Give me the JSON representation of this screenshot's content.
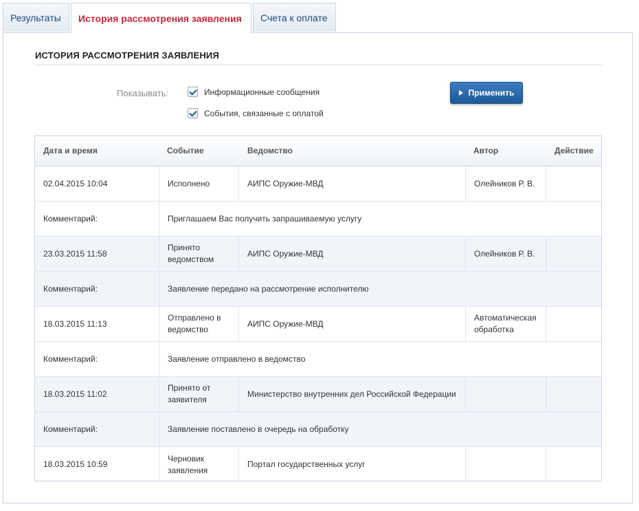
{
  "tabs": [
    {
      "label": "Результаты"
    },
    {
      "label": "История рассмотрения заявления"
    },
    {
      "label": "Счета к оплате"
    }
  ],
  "section_title": "ИСТОРИЯ РАССМОТРЕНИЯ ЗАЯВЛЕНИЯ",
  "filter": {
    "label": "Показывать:",
    "options": [
      {
        "label": "Информационные сообщения",
        "checked": true
      },
      {
        "label": "События, связанные с оплатой",
        "checked": true
      }
    ],
    "apply_label": "Применить"
  },
  "table": {
    "headers": {
      "date": "Дата и время",
      "event": "Событие",
      "dept": "Ведомство",
      "author": "Автор",
      "action": "Действие"
    },
    "comment_label": "Комментарий:",
    "rows": [
      {
        "date": "02.04.2015 10:04",
        "event": "Исполнено",
        "dept": "АИПС Оружие-МВД",
        "author": "Олейников Р. В.",
        "comment": "Приглашаем Вас получить запрашиваемую услугу"
      },
      {
        "date": "23.03.2015 11:58",
        "event": "Принято ведомством",
        "dept": "АИПС Оружие-МВД",
        "author": "Олейников Р. В.",
        "comment": "Заявление передано на рассмотрение исполнителю"
      },
      {
        "date": "18.03.2015 11:13",
        "event": "Отправлено в ведомство",
        "dept": "АИПС Оружие-МВД",
        "author": "Автоматическая обработка",
        "comment": "Заявление отправлено в ведомство"
      },
      {
        "date": "18.03.2015 11:02",
        "event": "Принято от заявителя",
        "dept": "Министерство внутренних дел Российской Федерации",
        "author": "",
        "comment": "Заявление поставлено в очередь на обработку"
      },
      {
        "date": "18.03.2015 10:59",
        "event": "Черновик заявления",
        "dept": "Портал государственных услуг",
        "author": "",
        "comment": null
      }
    ]
  }
}
